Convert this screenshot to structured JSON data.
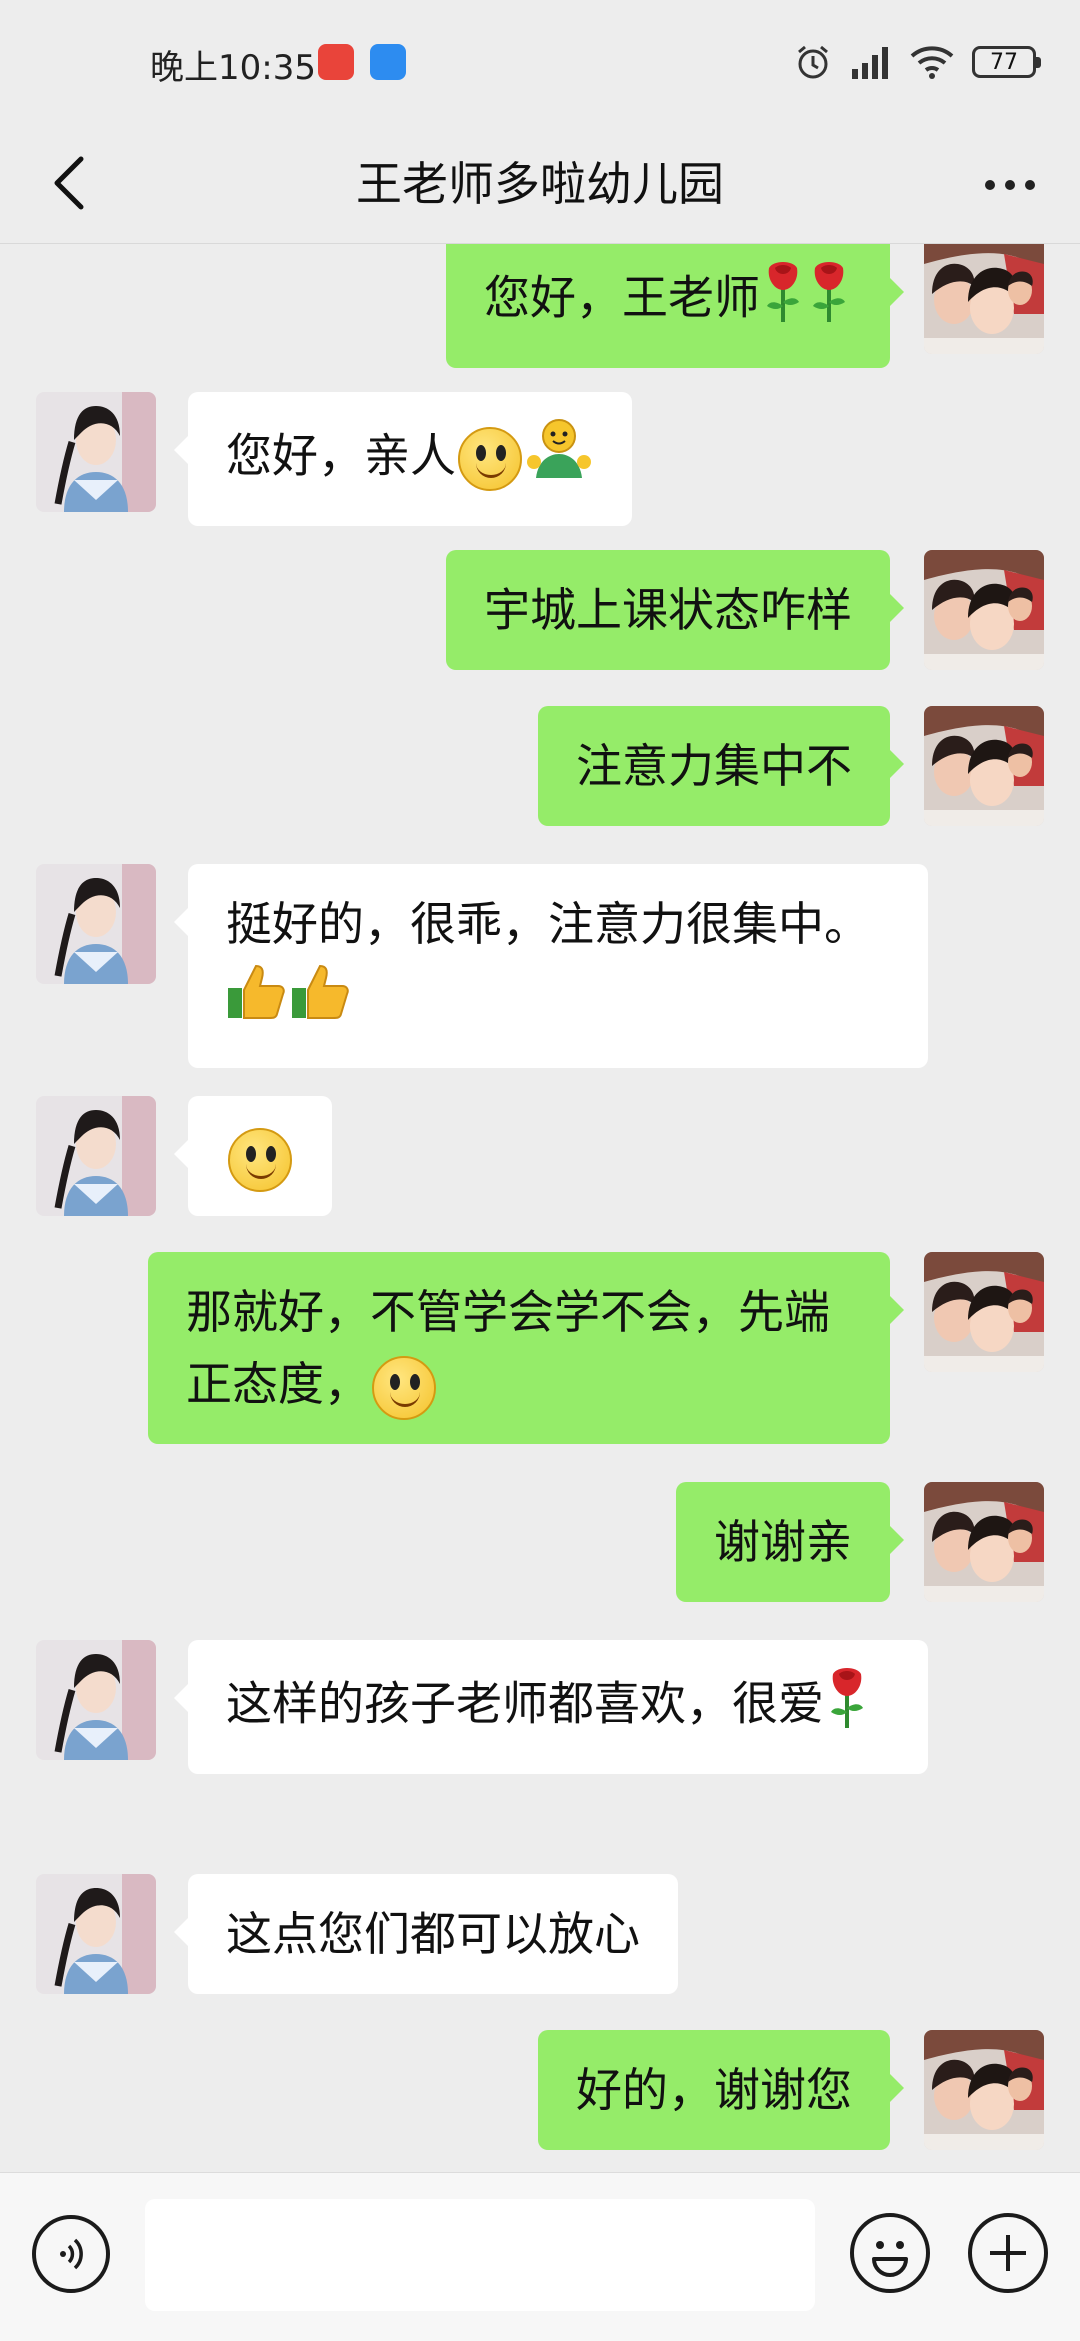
{
  "status_bar": {
    "time": "晚上10:35",
    "battery": "77",
    "badge_colors": [
      "#e9443a",
      "#2d8cf0"
    ]
  },
  "header": {
    "title": "王老师多啦幼儿园",
    "back_icon": "chevron-left-icon",
    "more_icon": "more-icon"
  },
  "messages": [
    {
      "side": "right",
      "text": "您好，王老师",
      "emoji": [
        "rose",
        "rose"
      ]
    },
    {
      "side": "left",
      "text": "您好，亲人",
      "emoji": [
        "smile",
        "hug"
      ]
    },
    {
      "side": "right",
      "text": "宇城上课状态咋样",
      "emoji": []
    },
    {
      "side": "right",
      "text": "注意力集中不",
      "emoji": []
    },
    {
      "side": "left",
      "text": "挺好的，很乖，注意力很集中。",
      "emoji": [
        "thumbs-up",
        "thumbs-up"
      ]
    },
    {
      "side": "left",
      "text": "",
      "emoji": [
        "smile"
      ]
    },
    {
      "side": "right",
      "text": "那就好，不管学会学不会，先端正态度，",
      "emoji": [
        "smile"
      ]
    },
    {
      "side": "right",
      "text": "谢谢亲",
      "emoji": []
    },
    {
      "side": "left",
      "text": "这样的孩子老师都喜欢，很爱",
      "emoji": [
        "rose"
      ]
    },
    {
      "side": "left",
      "text": "这点您们都可以放心",
      "emoji": []
    },
    {
      "side": "right",
      "text": "好的，谢谢您",
      "emoji": []
    }
  ],
  "input_bar": {
    "placeholder": "",
    "voice_icon": "voice-icon",
    "emoji_icon": "emoji-icon",
    "plus_icon": "plus-icon"
  },
  "colors": {
    "background": "#ededed",
    "sent_bubble": "#95ec69",
    "received_bubble": "#ffffff"
  }
}
